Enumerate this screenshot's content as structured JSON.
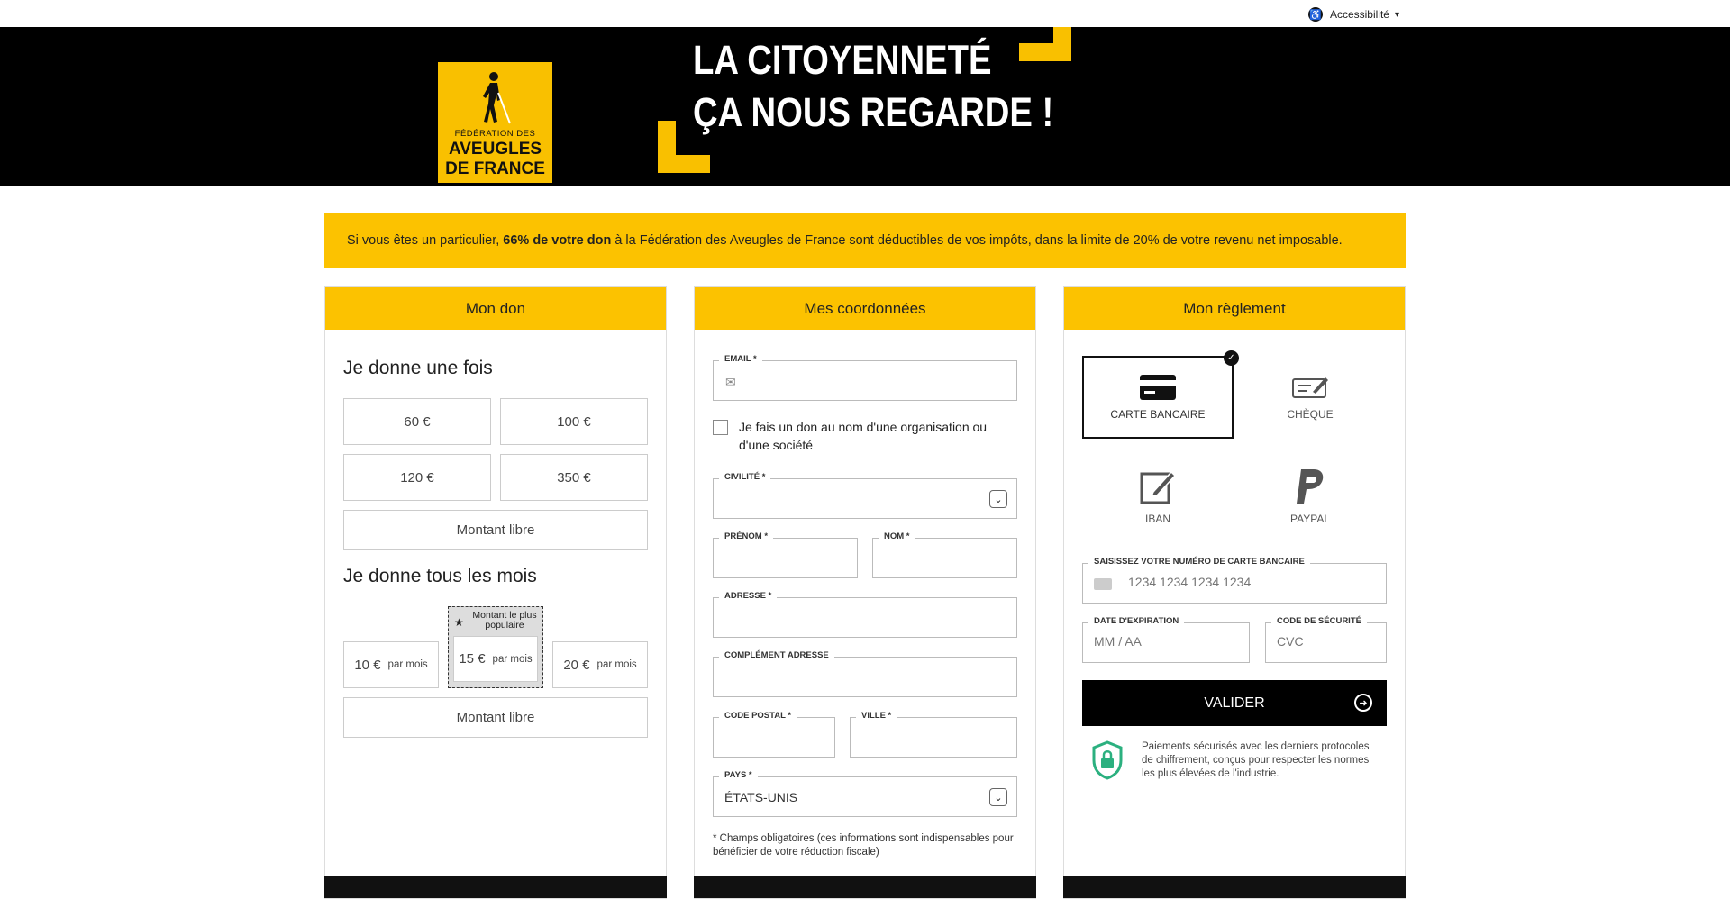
{
  "topbar": {
    "accessibility_label": "Accessibilité"
  },
  "banner": {
    "logo_line1": "FÉDÉRATION DES",
    "logo_line2": "AVEUGLES",
    "logo_line3": "DE FRANCE",
    "headline_line1": "LA CITOYENNETÉ",
    "headline_line2": "ÇA NOUS REGARDE !"
  },
  "notice": {
    "prefix": "Si vous êtes un particulier,",
    "bold": "66% de votre don",
    "suffix": "à la Fédération des Aveugles de France sont déductibles de vos impôts, dans la limite de 20% de votre revenu net imposable."
  },
  "don": {
    "title": "Mon don",
    "once_title": "Je donne une fois",
    "once_amounts": [
      "60 €",
      "100 €",
      "120 €",
      "350 €"
    ],
    "free_amount": "Montant libre",
    "monthly_title": "Je donne tous les mois",
    "monthly_amounts": [
      "10 €",
      "15 €",
      "20 €"
    ],
    "per_month": "par mois",
    "popular_label": "Montant le plus populaire",
    "free_amount_monthly": "Montant libre"
  },
  "coord": {
    "title": "Mes coordonnées",
    "email_label": "EMAIL *",
    "org_checkbox": "Je fais un don au nom d'une organisation ou d'une société",
    "civilite_label": "CIVILITÉ *",
    "prenom_label": "PRÉNOM *",
    "nom_label": "NOM *",
    "adresse_label": "ADRESSE *",
    "complement_label": "COMPLÉMENT ADRESSE",
    "cp_label": "CODE POSTAL *",
    "ville_label": "VILLE *",
    "pays_label": "PAYS *",
    "pays_value": "ÉTATS-UNIS",
    "required_note": "* Champs obligatoires (ces informations sont indispensables pour bénéficier de votre réduction fiscale)"
  },
  "reglement": {
    "title": "Mon règlement",
    "methods": [
      "CARTE BANCAIRE",
      "CHÈQUE",
      "IBAN",
      "PAYPAL"
    ],
    "card_label": "SAISISSEZ VOTRE NUMÉRO DE CARTE BANCAIRE",
    "card_placeholder": "1234 1234 1234 1234",
    "exp_label": "DATE D'EXPIRATION",
    "exp_placeholder": "MM / AA",
    "cvc_label": "CODE DE SÉCURITÉ",
    "cvc_placeholder": "CVC",
    "submit": "VALIDER",
    "secure_text": "Paiements sécurisés avec les derniers protocoles de chiffrement, conçus pour respecter les normes les plus élevées de l'industrie."
  },
  "colors": {
    "accent": "#fcc200",
    "dark": "#000000",
    "secure_green": "#2bb07f"
  },
  "icons": {
    "accessibility": "accessibility-icon",
    "check": "check-icon",
    "arrow": "arrow-right-circle-icon"
  }
}
